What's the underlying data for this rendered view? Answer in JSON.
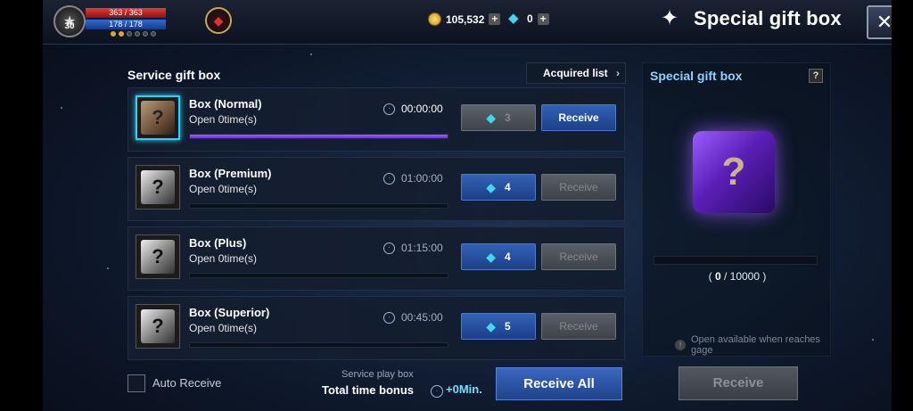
{
  "player": {
    "level": "30",
    "hp": "363 / 363",
    "mp": "178 / 178"
  },
  "currencies": {
    "gold": "105,532",
    "gems": "0"
  },
  "header": {
    "title": "Special gift box",
    "close_icon": "close-icon",
    "gift_icon": "gift-box-icon"
  },
  "service_panel": {
    "title": "Service gift box",
    "acquired_list_label": "Acquired list",
    "boxes": [
      {
        "name": "Box (Normal)",
        "opens": "Open 0time(s)",
        "time": "00:00:00",
        "gem_cost": "3",
        "receive_label": "Receive",
        "progress": 1.0,
        "receive_enabled": true,
        "gem_enabled": false
      },
      {
        "name": "Box (Premium)",
        "opens": "Open 0time(s)",
        "time": "01:00:00",
        "gem_cost": "4",
        "receive_label": "Receive",
        "progress": 0.0,
        "receive_enabled": false,
        "gem_enabled": true
      },
      {
        "name": "Box (Plus)",
        "opens": "Open 0time(s)",
        "time": "01:15:00",
        "gem_cost": "4",
        "receive_label": "Receive",
        "progress": 0.0,
        "receive_enabled": false,
        "gem_enabled": true
      },
      {
        "name": "Box (Superior)",
        "opens": "Open 0time(s)",
        "time": "00:45:00",
        "gem_cost": "5",
        "receive_label": "Receive",
        "progress": 0.0,
        "receive_enabled": false,
        "gem_enabled": true
      }
    ],
    "auto_receive_label": "Auto Receive",
    "service_play_label": "Service play box",
    "total_bonus_label": "Total time bonus",
    "bonus_value": "+0Min.",
    "receive_all_label": "Receive All"
  },
  "special_panel": {
    "title": "Special gift box",
    "help_label": "?",
    "gauge_current": "0",
    "gauge_max": "10000",
    "gauge_fraction": 0.0,
    "note": "Open available when reaches gage",
    "receive_label": "Receive"
  }
}
